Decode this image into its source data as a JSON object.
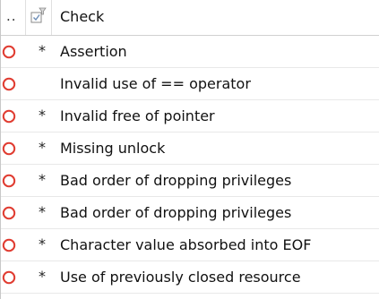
{
  "header": {
    "dots_label": "..",
    "check_label": "Check"
  },
  "colors": {
    "status_circle": "#e03c31",
    "grid_line": "#e0e0e0"
  },
  "icons": {
    "header_icon": "checkbox-filter-icon",
    "status_icon": "red-circle-icon"
  },
  "rows": [
    {
      "justified": "*",
      "check": "Assertion"
    },
    {
      "justified": "",
      "check": "Invalid use of == operator"
    },
    {
      "justified": "*",
      "check": "Invalid free of pointer"
    },
    {
      "justified": "*",
      "check": "Missing unlock"
    },
    {
      "justified": "*",
      "check": "Bad order of dropping privileges"
    },
    {
      "justified": "*",
      "check": "Bad order of dropping privileges"
    },
    {
      "justified": "*",
      "check": "Character value absorbed into EOF"
    },
    {
      "justified": "*",
      "check": "Use of previously closed resource"
    }
  ]
}
